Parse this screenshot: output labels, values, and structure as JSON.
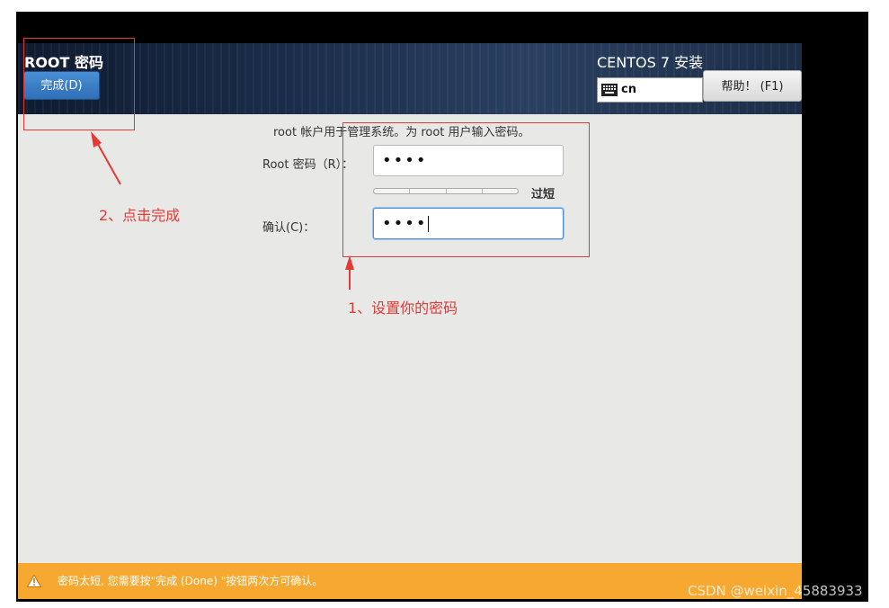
{
  "header": {
    "page_title": "ROOT 密码",
    "done_button": "完成(D)",
    "install_title": "CENTOS 7 安装",
    "keyboard_layout": "cn",
    "help_button": "帮助！ (F1)"
  },
  "form": {
    "info": "root 帐户用于管理系统。为 root 用户输入密码。",
    "root_label": "Root 密码（R）：",
    "root_value": "••••",
    "strength_label": "过短",
    "confirm_label": "确认(C)：",
    "confirm_value": "••••"
  },
  "warning": {
    "text": "密码太短, 您需要按\"完成 (Done) \"按钮两次方可确认。"
  },
  "annotations": {
    "step1": "1、设置你的密码",
    "step2": "2、点击完成"
  },
  "watermark": "CSDN @weixin_45883933",
  "colors": {
    "annotation_red": "#e53935",
    "warning_orange": "#f6a830",
    "done_blue": "#2f6fb8"
  }
}
